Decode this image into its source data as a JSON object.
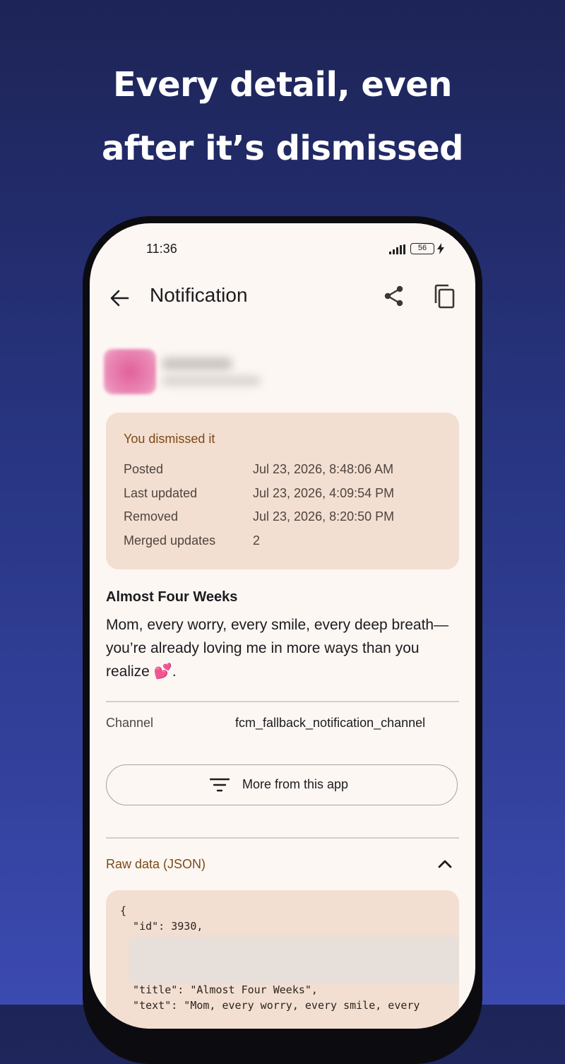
{
  "headline": {
    "line1": "Every detail, even",
    "line2": "after it’s dismissed"
  },
  "status_bar": {
    "time": "11:36",
    "battery": "56"
  },
  "toolbar": {
    "title": "Notification"
  },
  "info_card": {
    "status": "You dismissed it",
    "rows": [
      {
        "label": "Posted",
        "value": "Jul 23, 2026, 8:48:06 AM"
      },
      {
        "label": "Last updated",
        "value": "Jul 23, 2026, 4:09:54 PM"
      },
      {
        "label": "Removed",
        "value": "Jul 23, 2026, 8:20:50 PM"
      },
      {
        "label": "Merged updates",
        "value": "2"
      }
    ]
  },
  "notification": {
    "title": "Almost Four Weeks",
    "text": "Mom, every worry, every smile, every deep breath—you’re already loving me in more ways than you realize 💕."
  },
  "channel": {
    "label": "Channel",
    "value": "fcm_fallback_notification_channel"
  },
  "more_button": {
    "label": "More from this app"
  },
  "raw_data": {
    "label": "Raw data (JSON)",
    "lines": [
      "{",
      "  \"id\": 3930,",
      "  \"title\": \"Almost Four Weeks\",",
      "  \"text\": \"Mom, every worry, every smile, every"
    ]
  },
  "colors": {
    "background_top": "#1d2456",
    "background_bottom": "#3b4ab0",
    "screen_bg": "#fdf7f3",
    "card_bg": "#f3dfd1",
    "accent_brown": "#7b4a17"
  },
  "icons": {
    "back": "arrow-left-icon",
    "share": "share-icon",
    "copy": "copy-icon",
    "filter": "filter-icon",
    "collapse": "chevron-up-icon"
  }
}
